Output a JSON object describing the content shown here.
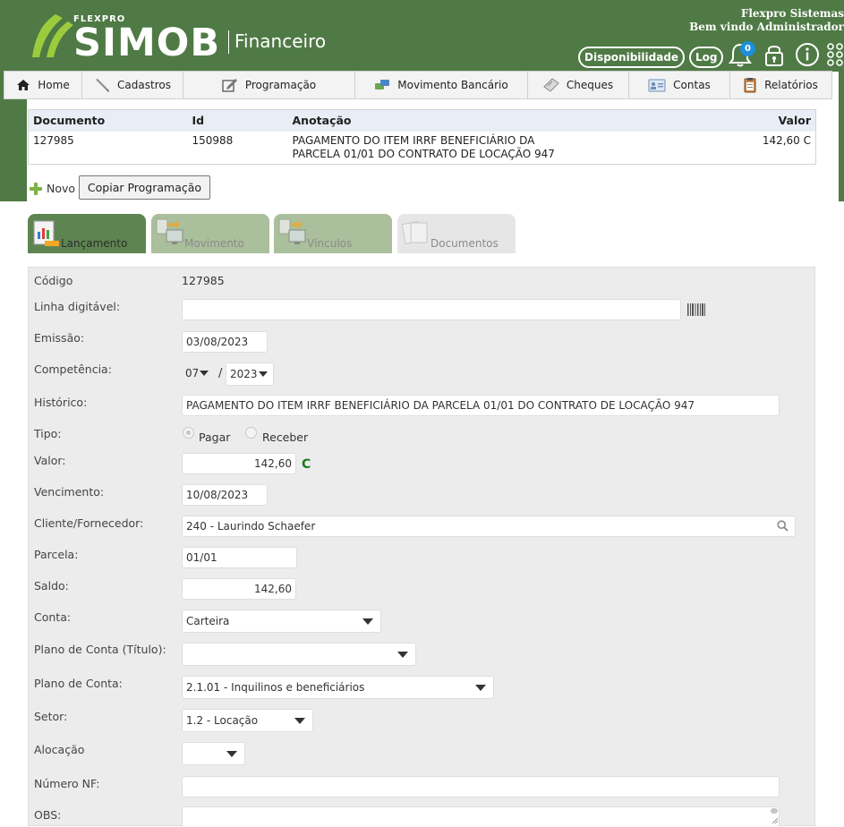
{
  "colors": {
    "header_green": "#4f7a45",
    "value_green": "#1d7a1d",
    "badge_blue": "#1d8fd8"
  },
  "logo": {
    "flexpro": "FLEXPRO",
    "simob": "SIMOB",
    "module": "Financeiro"
  },
  "header": {
    "company": "Flexpro Sistemas",
    "welcome": "Bem vindo Administrador",
    "disponibilidade": "Disponibilidade",
    "log": "Log",
    "notifications_count": "0",
    "icons": [
      "bell-icon",
      "lock-icon",
      "info-icon",
      "grid-menu-icon"
    ]
  },
  "nav": [
    {
      "label": "Home",
      "icon": "home-icon"
    },
    {
      "label": "Cadastros",
      "icon": "pencil-icon"
    },
    {
      "label": "Programação",
      "icon": "edit-icon"
    },
    {
      "label": "Movimento Bancário",
      "icon": "money-icon"
    },
    {
      "label": "Cheques",
      "icon": "cheque-icon"
    },
    {
      "label": "Contas",
      "icon": "contacts-icon"
    },
    {
      "label": "Relatórios",
      "icon": "report-icon"
    }
  ],
  "summary": {
    "headers": [
      "Documento",
      "Id",
      "Anotação",
      "Valor"
    ],
    "row": {
      "documento": "127985",
      "id": "150988",
      "anotacao": "PAGAMENTO DO ITEM IRRF BENEFICIÁRIO DA PARCELA 01/01 DO CONTRATO DE LOCAÇÃO 947",
      "valor": "142,60 C"
    }
  },
  "actions": {
    "novo": "Novo",
    "copiar": "Copiar Programação"
  },
  "tabs": [
    {
      "label": "Lançamento",
      "active": true
    },
    {
      "label": "Movimento",
      "active": false
    },
    {
      "label": "Vínculos",
      "active": false
    },
    {
      "label": "Documentos",
      "active": false
    }
  ],
  "form": {
    "codigo": {
      "label": "Código",
      "value": "127985"
    },
    "linha_digitavel": {
      "label": "Linha digitável:",
      "value": ""
    },
    "emissao": {
      "label": "Emissão:",
      "value": "03/08/2023"
    },
    "competencia": {
      "label": "Competência:",
      "month": "07",
      "separator": "/",
      "year": "2023"
    },
    "historico": {
      "label": "Histórico:",
      "value": "PAGAMENTO DO ITEM IRRF BENEFICIÁRIO DA PARCELA 01/01 DO CONTRATO DE LOCAÇÃO 947"
    },
    "tipo": {
      "label": "Tipo:",
      "options": [
        "Pagar",
        "Receber"
      ],
      "selected": "Pagar"
    },
    "valor": {
      "label": "Valor:",
      "value": "142,60",
      "indicator": "C"
    },
    "vencimento": {
      "label": "Vencimento:",
      "value": "10/08/2023"
    },
    "cliente": {
      "label": "Cliente/Fornecedor:",
      "value": "240 - Laurindo Schaefer"
    },
    "parcela": {
      "label": "Parcela:",
      "value": "01/01"
    },
    "saldo": {
      "label": "Saldo:",
      "value": "142,60"
    },
    "conta": {
      "label": "Conta:",
      "value": "Carteira"
    },
    "plano_titulo": {
      "label": "Plano de Conta (Título):",
      "value": ""
    },
    "plano_conta": {
      "label": "Plano de Conta:",
      "value": "2.1.01 - Inquilinos e beneficiários"
    },
    "setor": {
      "label": "Setor:",
      "value": "1.2 - Locação"
    },
    "alocacao": {
      "label": "Alocação",
      "value": ""
    },
    "numero_nf": {
      "label": "Número NF:",
      "value": ""
    },
    "obs": {
      "label": "OBS:",
      "value": ""
    }
  }
}
